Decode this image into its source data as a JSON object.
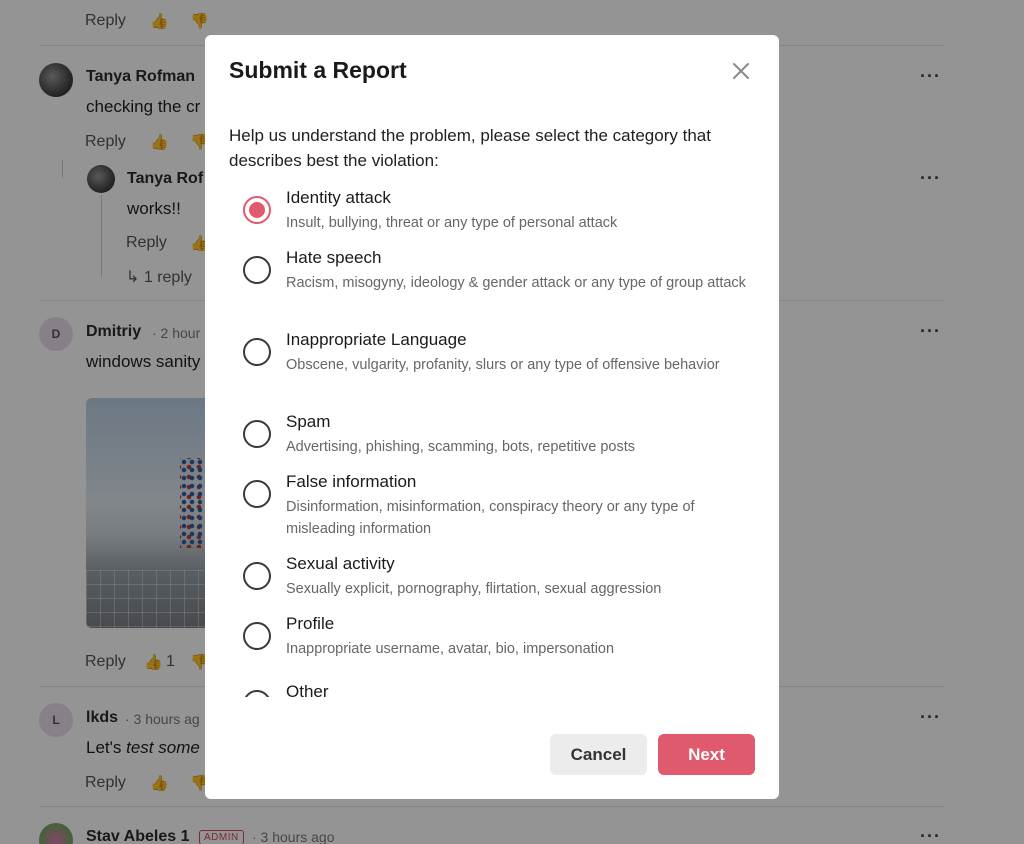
{
  "feed": {
    "reply_label": "Reply",
    "comments": [
      {
        "author": "Tanya Rofman",
        "text": "checking the cr"
      },
      {
        "author": "Tanya Rof",
        "text": "works!!",
        "replies": "1 reply"
      },
      {
        "author": "Dmitriy",
        "initial": "D",
        "time": "· 2 hour",
        "text": "windows sanity",
        "likes": "1"
      },
      {
        "author": "lkds",
        "initial": "L",
        "time": "· 3 hours ag",
        "text_prefix": "Let's ",
        "text_italic": "test some"
      },
      {
        "author": "Stav Abeles 1",
        "badge": "ADMIN",
        "time": "· 3 hours ago"
      }
    ]
  },
  "modal": {
    "title": "Submit a Report",
    "prompt": "Help us understand the problem, please select the category that describes best the violation:",
    "selected": 0,
    "options": [
      {
        "label": "Identity attack",
        "description": "Insult, bullying, threat or any type of personal attack"
      },
      {
        "label": "Hate speech",
        "description": "Racism, misogyny, ideology & gender attack or any type of group attack"
      },
      {
        "label": "Inappropriate Language",
        "description": "Obscene, vulgarity, profanity, slurs or any type of offensive behavior"
      },
      {
        "label": "Spam",
        "description": "Advertising, phishing, scamming, bots, repetitive posts"
      },
      {
        "label": "False information",
        "description": "Disinformation, misinformation, conspiracy theory or any type of misleading information"
      },
      {
        "label": "Sexual activity",
        "description": "Sexually explicit, pornography, flirtation, sexual aggression"
      },
      {
        "label": "Profile",
        "description": "Inappropriate username, avatar, bio, impersonation"
      },
      {
        "label": "Other",
        "description": ""
      }
    ],
    "cancel_label": "Cancel",
    "next_label": "Next",
    "accent_color": "#e05a6d"
  }
}
